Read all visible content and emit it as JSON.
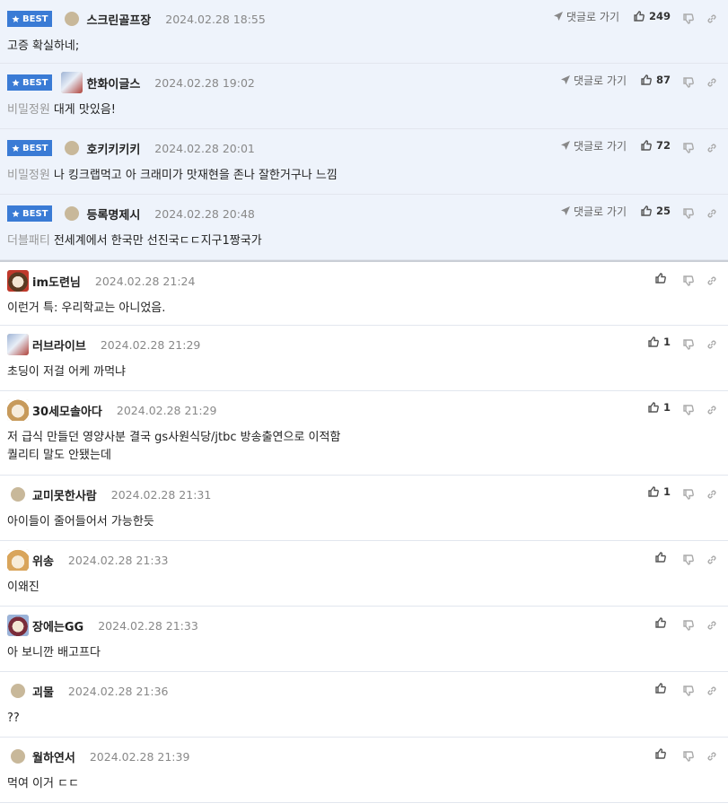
{
  "badge_label": "BEST",
  "reply_link_label": "댓글로 가기",
  "best": [
    {
      "nick": "스크린골프장",
      "date": "2024.02.28 18:55",
      "prefix": "",
      "text": "고증 확실하네;",
      "likes": "249",
      "avatar": "dot"
    },
    {
      "nick": "한화이글스",
      "date": "2024.02.28 19:02",
      "prefix": "비밀정원",
      "text": "대게 맛있음!",
      "likes": "87",
      "avatar": "pic"
    },
    {
      "nick": "호키키키키",
      "date": "2024.02.28 20:01",
      "prefix": "비밀정원",
      "text": "나 킹크랩먹고 아 크래미가 맛재현을 존나 잘한거구나 느낌",
      "likes": "72",
      "avatar": "dot"
    },
    {
      "nick": "등록명제시",
      "date": "2024.02.28 20:48",
      "prefix": "더블패티",
      "text": "전세계에서 한국만 선진국ㄷㄷ지구1짱국가",
      "likes": "25",
      "avatar": "dot"
    }
  ],
  "comments": [
    {
      "nick": "im도련님",
      "date": "2024.02.28 21:24",
      "text": "이런거 특: 우리학교는 아니었음.",
      "likes": "",
      "avatar": "pic"
    },
    {
      "nick": "러브라이브",
      "date": "2024.02.28 21:29",
      "text": "초딩이 저걸 어케 까먹냐",
      "likes": "1",
      "avatar": "pic"
    },
    {
      "nick": "30세모솔아다",
      "date": "2024.02.28 21:29",
      "text": "저 급식 만들던 영양사분 결국 gs사원식당/jtbc 방송출연으로 이적함\n퀄리티 말도 안됐는데",
      "likes": "1",
      "avatar": "pic"
    },
    {
      "nick": "교미못한사람",
      "date": "2024.02.28 21:31",
      "text": "아이들이 줄어들어서 가능한듯",
      "likes": "1",
      "avatar": "dot"
    },
    {
      "nick": "위송",
      "date": "2024.02.28 21:33",
      "text": "이왜진",
      "likes": "",
      "avatar": "pic"
    },
    {
      "nick": "장에는GG",
      "date": "2024.02.28 21:33",
      "text": "아 보니깐 배고프다",
      "likes": "",
      "avatar": "pic"
    },
    {
      "nick": "괴물",
      "date": "2024.02.28 21:36",
      "text": "??",
      "likes": "",
      "avatar": "dot"
    },
    {
      "nick": "월하연서",
      "date": "2024.02.28 21:39",
      "text": "먹여 이거 ㄷㄷ",
      "likes": "",
      "avatar": "dot"
    }
  ],
  "colors": {
    "badge": "#3a7bd5",
    "best_bg": "#eef3fb",
    "avatar_dot": "#c8b89a"
  },
  "icons": [
    "star-icon",
    "arrow-icon",
    "thumbs-up-icon",
    "thumbs-down-icon",
    "link-icon"
  ]
}
